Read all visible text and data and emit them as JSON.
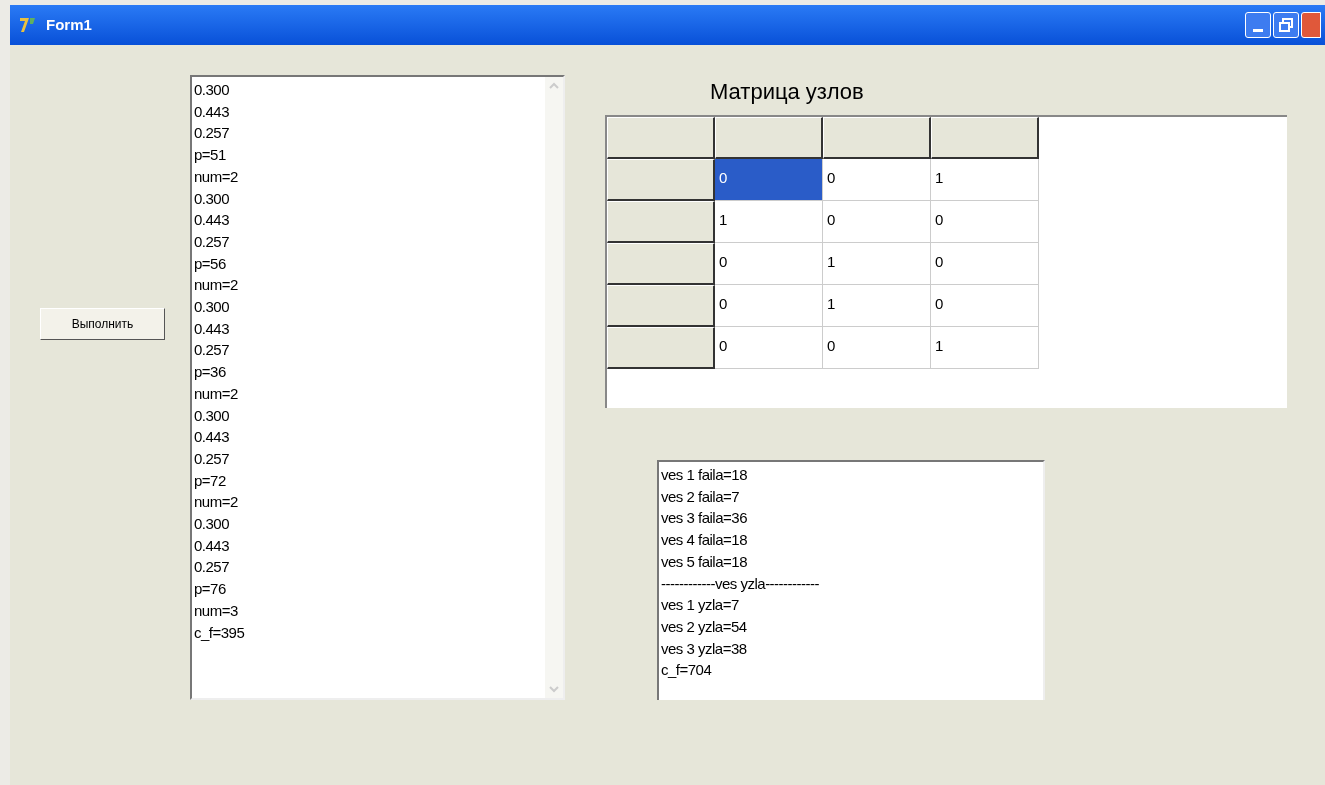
{
  "window": {
    "title": "Form1"
  },
  "run_button": {
    "label": "Выполнить"
  },
  "output_memo": {
    "lines": [
      "0.300",
      "0.443",
      "0.257",
      "p=51",
      "num=2",
      "0.300",
      "0.443",
      "0.257",
      "p=56",
      "num=2",
      "0.300",
      "0.443",
      "0.257",
      "p=36",
      "num=2",
      "0.300",
      "0.443",
      "0.257",
      "p=72",
      "num=2",
      "0.300",
      "0.443",
      "0.257",
      "p=76",
      "num=3",
      "c_f=395"
    ]
  },
  "matrix": {
    "title": "Матрица узлов",
    "rows": [
      {
        "cells": [
          {
            "value": "0",
            "selected": true
          },
          {
            "value": "0",
            "selected": false
          },
          {
            "value": "1",
            "selected": false
          }
        ]
      },
      {
        "cells": [
          {
            "value": "1",
            "selected": false
          },
          {
            "value": "0",
            "selected": false
          },
          {
            "value": "0",
            "selected": false
          }
        ]
      },
      {
        "cells": [
          {
            "value": "0",
            "selected": false
          },
          {
            "value": "1",
            "selected": false
          },
          {
            "value": "0",
            "selected": false
          }
        ]
      },
      {
        "cells": [
          {
            "value": "0",
            "selected": false
          },
          {
            "value": "1",
            "selected": false
          },
          {
            "value": "0",
            "selected": false
          }
        ]
      },
      {
        "cells": [
          {
            "value": "0",
            "selected": false
          },
          {
            "value": "0",
            "selected": false
          },
          {
            "value": "1",
            "selected": false
          }
        ]
      }
    ]
  },
  "result_memo": {
    "lines": [
      "ves 1 faila=18",
      "ves 2 faila=7",
      "ves 3 faila=36",
      "ves 4 faila=18",
      "ves 5 faila=18",
      "------------ves yzla------------",
      "ves 1 yzla=7",
      "ves 2 yzla=54",
      "ves 3 yzla=38",
      "c_f=704"
    ]
  }
}
